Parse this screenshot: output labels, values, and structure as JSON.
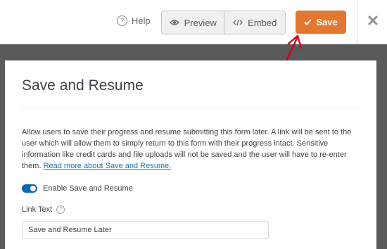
{
  "topbar": {
    "help_label": "Help",
    "preview_label": "Preview",
    "embed_label": "Embed",
    "save_label": "Save"
  },
  "panel": {
    "title": "Save and Resume",
    "description": "Allow users to save their progress and resume submitting this form later. A link will be sent to the user which will allow them to simply return to this form with their progress intact. Sensitive information like credit cards and file uploads will not be saved and the user will have to re-enter them.",
    "read_more_link": "Read more about Save and Resume.",
    "toggle_label": "Enable Save and Resume",
    "toggle_on": true,
    "link_text_label": "Link Text",
    "link_text_value": "Save and Resume Later"
  },
  "colors": {
    "save_button": "#e27730",
    "toggle": "#056aab",
    "link": "#2271b1",
    "arrow": "#d0021b"
  },
  "icons": {
    "help": "question-circle-icon",
    "preview": "eye-icon",
    "embed": "code-icon",
    "save": "checkmark-icon",
    "close": "close-icon",
    "tooltip": "question-circle-icon"
  }
}
